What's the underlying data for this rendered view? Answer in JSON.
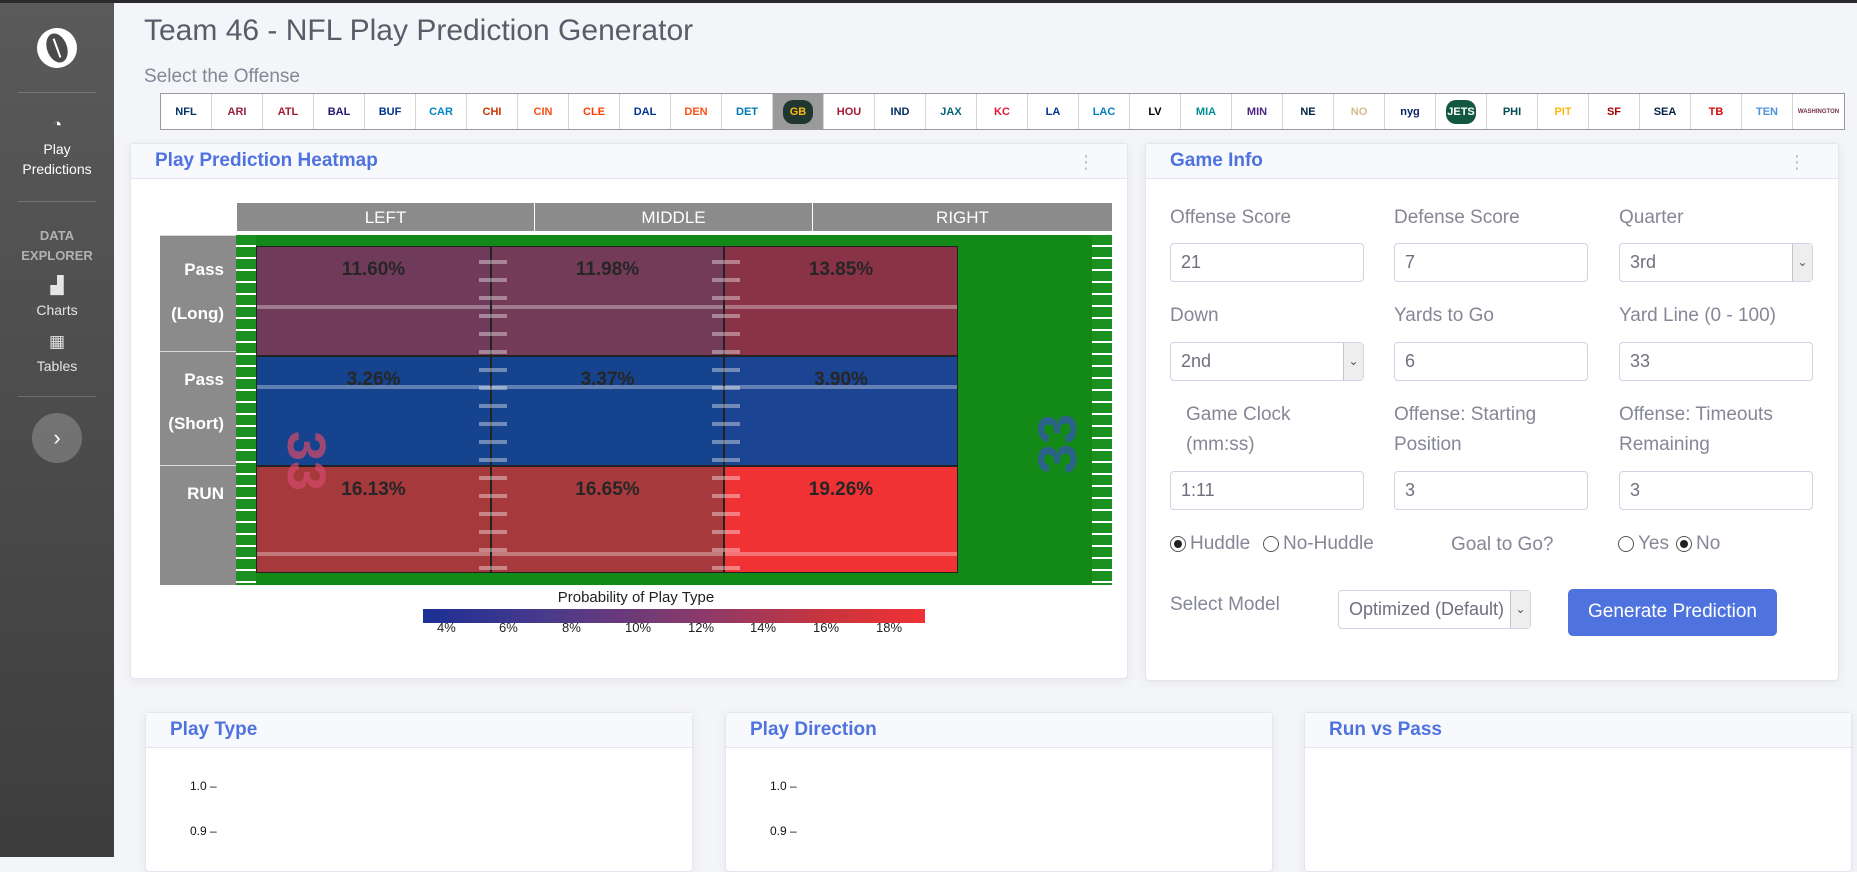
{
  "app": {
    "title": "Team 46 - NFL Play Prediction Generator",
    "subtitle": "Select the Offense"
  },
  "sidebar": {
    "brand_icon": "football-icon",
    "play_predictions": "Play Predictions",
    "section_heading": "DATA EXPLORER",
    "charts": "Charts",
    "tables": "Tables",
    "toggle_icon": "chevron-right-icon"
  },
  "teams": [
    {
      "abbr": "NFL",
      "color": "#013369",
      "bg": "#ffffff"
    },
    {
      "abbr": "ARI",
      "color": "#97233F",
      "bg": "#ffffff"
    },
    {
      "abbr": "ATL",
      "color": "#A71930",
      "bg": "#ffffff"
    },
    {
      "abbr": "BAL",
      "color": "#241773",
      "bg": "#ffffff"
    },
    {
      "abbr": "BUF",
      "color": "#00338D",
      "bg": "#ffffff"
    },
    {
      "abbr": "CAR",
      "color": "#0085CA",
      "bg": "#ffffff"
    },
    {
      "abbr": "CHI",
      "color": "#C83803",
      "bg": "#ffffff"
    },
    {
      "abbr": "CIN",
      "color": "#FB4F14",
      "bg": "#ffffff"
    },
    {
      "abbr": "CLE",
      "color": "#FF3C00",
      "bg": "#ffffff"
    },
    {
      "abbr": "DAL",
      "color": "#003594",
      "bg": "#ffffff"
    },
    {
      "abbr": "DEN",
      "color": "#FB4F14",
      "bg": "#ffffff"
    },
    {
      "abbr": "DET",
      "color": "#0076B6",
      "bg": "#ffffff"
    },
    {
      "abbr": "GB",
      "color": "#FFB612",
      "bg": "#203731"
    },
    {
      "abbr": "HOU",
      "color": "#A71930",
      "bg": "#ffffff"
    },
    {
      "abbr": "IND",
      "color": "#002C5F",
      "bg": "#ffffff"
    },
    {
      "abbr": "JAX",
      "color": "#006778",
      "bg": "#ffffff"
    },
    {
      "abbr": "KC",
      "color": "#E31837",
      "bg": "#ffffff"
    },
    {
      "abbr": "LA",
      "color": "#003594",
      "bg": "#ffffff"
    },
    {
      "abbr": "LAC",
      "color": "#0080C6",
      "bg": "#ffffff"
    },
    {
      "abbr": "LV",
      "color": "#000000",
      "bg": "#ffffff"
    },
    {
      "abbr": "MIA",
      "color": "#008E97",
      "bg": "#ffffff"
    },
    {
      "abbr": "MIN",
      "color": "#4F2683",
      "bg": "#ffffff"
    },
    {
      "abbr": "NE",
      "color": "#002244",
      "bg": "#ffffff"
    },
    {
      "abbr": "NO",
      "color": "#D3BC8D",
      "bg": "#ffffff"
    },
    {
      "abbr": "nyg",
      "color": "#0B2265",
      "bg": "#ffffff"
    },
    {
      "abbr": "JETS",
      "color": "#ffffff",
      "bg": "#125740"
    },
    {
      "abbr": "PHI",
      "color": "#004C54",
      "bg": "#ffffff"
    },
    {
      "abbr": "PIT",
      "color": "#FFB612",
      "bg": "#ffffff"
    },
    {
      "abbr": "SF",
      "color": "#AA0000",
      "bg": "#ffffff"
    },
    {
      "abbr": "SEA",
      "color": "#002244",
      "bg": "#ffffff"
    },
    {
      "abbr": "TB",
      "color": "#D50A0A",
      "bg": "#ffffff"
    },
    {
      "abbr": "TEN",
      "color": "#4B92DB",
      "bg": "#ffffff"
    },
    {
      "abbr": "WASHINGTON",
      "color": "#773141",
      "bg": "#ffffff"
    }
  ],
  "selected_team_index": 12,
  "heatmap": {
    "card_title": "Play Prediction Heatmap",
    "columns": [
      "LEFT",
      "MIDDLE",
      "RIGHT"
    ],
    "rows": [
      {
        "line1": "Pass",
        "line2": "(Long)"
      },
      {
        "line1": "Pass",
        "line2": "(Short)"
      },
      {
        "line1": "RUN",
        "line2": ""
      }
    ],
    "cells": [
      [
        {
          "label": "11.60%",
          "color": "#703b5a"
        },
        {
          "label": "11.98%",
          "color": "#733b58"
        },
        {
          "label": "13.85%",
          "color": "#8a3346"
        }
      ],
      [
        {
          "label": "3.26%",
          "color": "#16438e"
        },
        {
          "label": "3.37%",
          "color": "#16438e"
        },
        {
          "label": "3.90%",
          "color": "#1b4492"
        }
      ],
      [
        {
          "label": "16.13%",
          "color": "#a6393b"
        },
        {
          "label": "16.65%",
          "color": "#a83a3d"
        },
        {
          "label": "19.26%",
          "color": "#f03234"
        }
      ]
    ],
    "yard_number": "33",
    "legend_title": "Probability of Play Type",
    "legend_ticks": [
      "4%",
      "6%",
      "8%",
      "10%",
      "12%",
      "14%",
      "16%",
      "18%"
    ]
  },
  "game_info": {
    "card_title": "Game Info",
    "offense_score": {
      "label": "Offense Score",
      "value": "21"
    },
    "defense_score": {
      "label": "Defense Score",
      "value": "7"
    },
    "quarter": {
      "label": "Quarter",
      "value": "3rd"
    },
    "down": {
      "label": "Down",
      "value": "2nd"
    },
    "yards_to_go": {
      "label": "Yards to Go",
      "value": "6"
    },
    "yard_line": {
      "label": "Yard Line (0 - 100)",
      "value": "33"
    },
    "game_clock": {
      "label_line1": "Game Clock",
      "label_line2": "(mm:ss)",
      "value": "1:11"
    },
    "starting_position": {
      "label_line1": "Offense: Starting",
      "label_line2": "Position",
      "value": "3"
    },
    "timeouts": {
      "label_line1": "Offense: Timeouts",
      "label_line2": "Remaining",
      "value": "3"
    },
    "huddle": "Huddle",
    "no_huddle": "No-Huddle",
    "huddle_selected": "Huddle",
    "goal_to_go": "Goal to Go?",
    "yes": "Yes",
    "no": "No",
    "goal_selected": "No",
    "select_model_label": "Select Model",
    "model": "Optimized (Default)",
    "generate_button": "Generate Prediction"
  },
  "bottom_cards": {
    "play_type": {
      "title": "Play Type",
      "y_ticks": [
        "1.0",
        "0.9"
      ]
    },
    "play_direction": {
      "title": "Play Direction",
      "y_ticks": [
        "1.0",
        "0.9"
      ]
    },
    "run_vs_pass": {
      "title": "Run vs Pass"
    }
  }
}
